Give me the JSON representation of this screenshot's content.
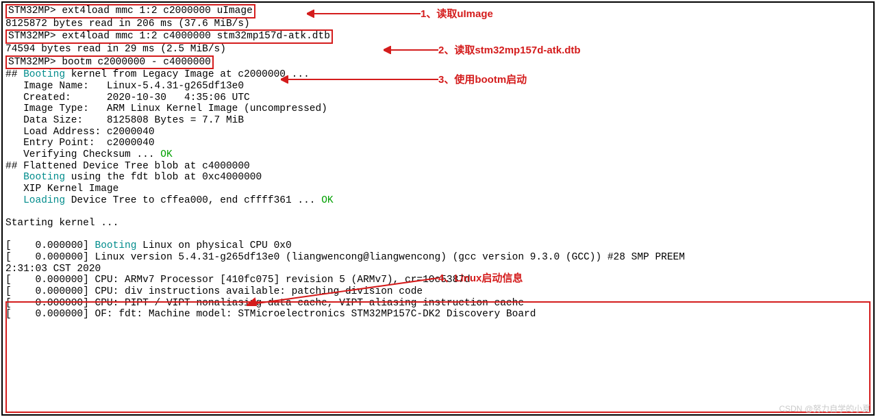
{
  "annotations": {
    "a1": "1、读取uImage",
    "a2": "2、读取stm32mp157d-atk.dtb",
    "a3": "3、使用bootm启动",
    "a4": "4、Linux启动信息"
  },
  "prompts": {
    "p1": "STM32MP> ",
    "p2": "STM32MP> ",
    "p3": "STM32MP> "
  },
  "cmds": {
    "c1": "ext4load mmc 1:2 c2000000 uImage",
    "c2": "ext4load mmc 1:2 c4000000 stm32mp157d-atk.dtb",
    "c3": "bootm c2000000 - c4000000"
  },
  "out": {
    "r1": "8125872 bytes read in 206 ms (37.6 MiB/s)",
    "r2": "74594 bytes read in 29 ms (2.5 MiB/s)",
    "l1a": "## ",
    "l1b": "Booting",
    "l1c": " kernel from Legacy Image at c2000000 ...",
    "l2": "   Image Name:   Linux-5.4.31-g265df13e0",
    "l3": "   Created:      2020-10-30   4:35:06 UTC",
    "l4": "   Image Type:   ARM Linux Kernel Image (uncompressed)",
    "l5": "   Data Size:    8125808 Bytes = 7.7 MiB",
    "l6": "   Load Address: c2000040",
    "l7": "   Entry Point:  c2000040",
    "l8a": "   Verifying Checksum ... ",
    "l8b": "OK",
    "l9": "## Flattened Device Tree blob at c4000000",
    "l10a": "   ",
    "l10b": "Booting",
    "l10c": " using the fdt blob at 0xc4000000",
    "l11": "   XIP Kernel Image",
    "l12a": "   ",
    "l12b": "Loading",
    "l12c": " Device Tree to cffea000, end cffff361 ... ",
    "l12d": "OK",
    "blank": " ",
    "l13": "Starting kernel ...",
    "k1a": "[    0.000000] ",
    "k1b": "Booting",
    "k1c": " Linux on physical CPU 0x0",
    "k2": "[    0.000000] Linux version 5.4.31-g265df13e0 (liangwencong@liangwencong) (gcc version 9.3.0 (GCC)) #28 SMP PREEM",
    "k2b": "2:31:03 CST 2020",
    "k3": "[    0.000000] CPU: ARMv7 Processor [410fc075] revision 5 (ARMv7), cr=10c5387d",
    "k4": "[    0.000000] CPU: div instructions available: patching division code",
    "k5": "[    0.000000] CPU: PIPT / VIPT nonaliasing data cache, VIPT aliasing instruction cache",
    "k6": "[    0.000000] OF: fdt: Machine model: STMicroelectronics STM32MP157C-DK2 Discovery Board"
  },
  "watermark": "CSDN @努力自学的小夏"
}
